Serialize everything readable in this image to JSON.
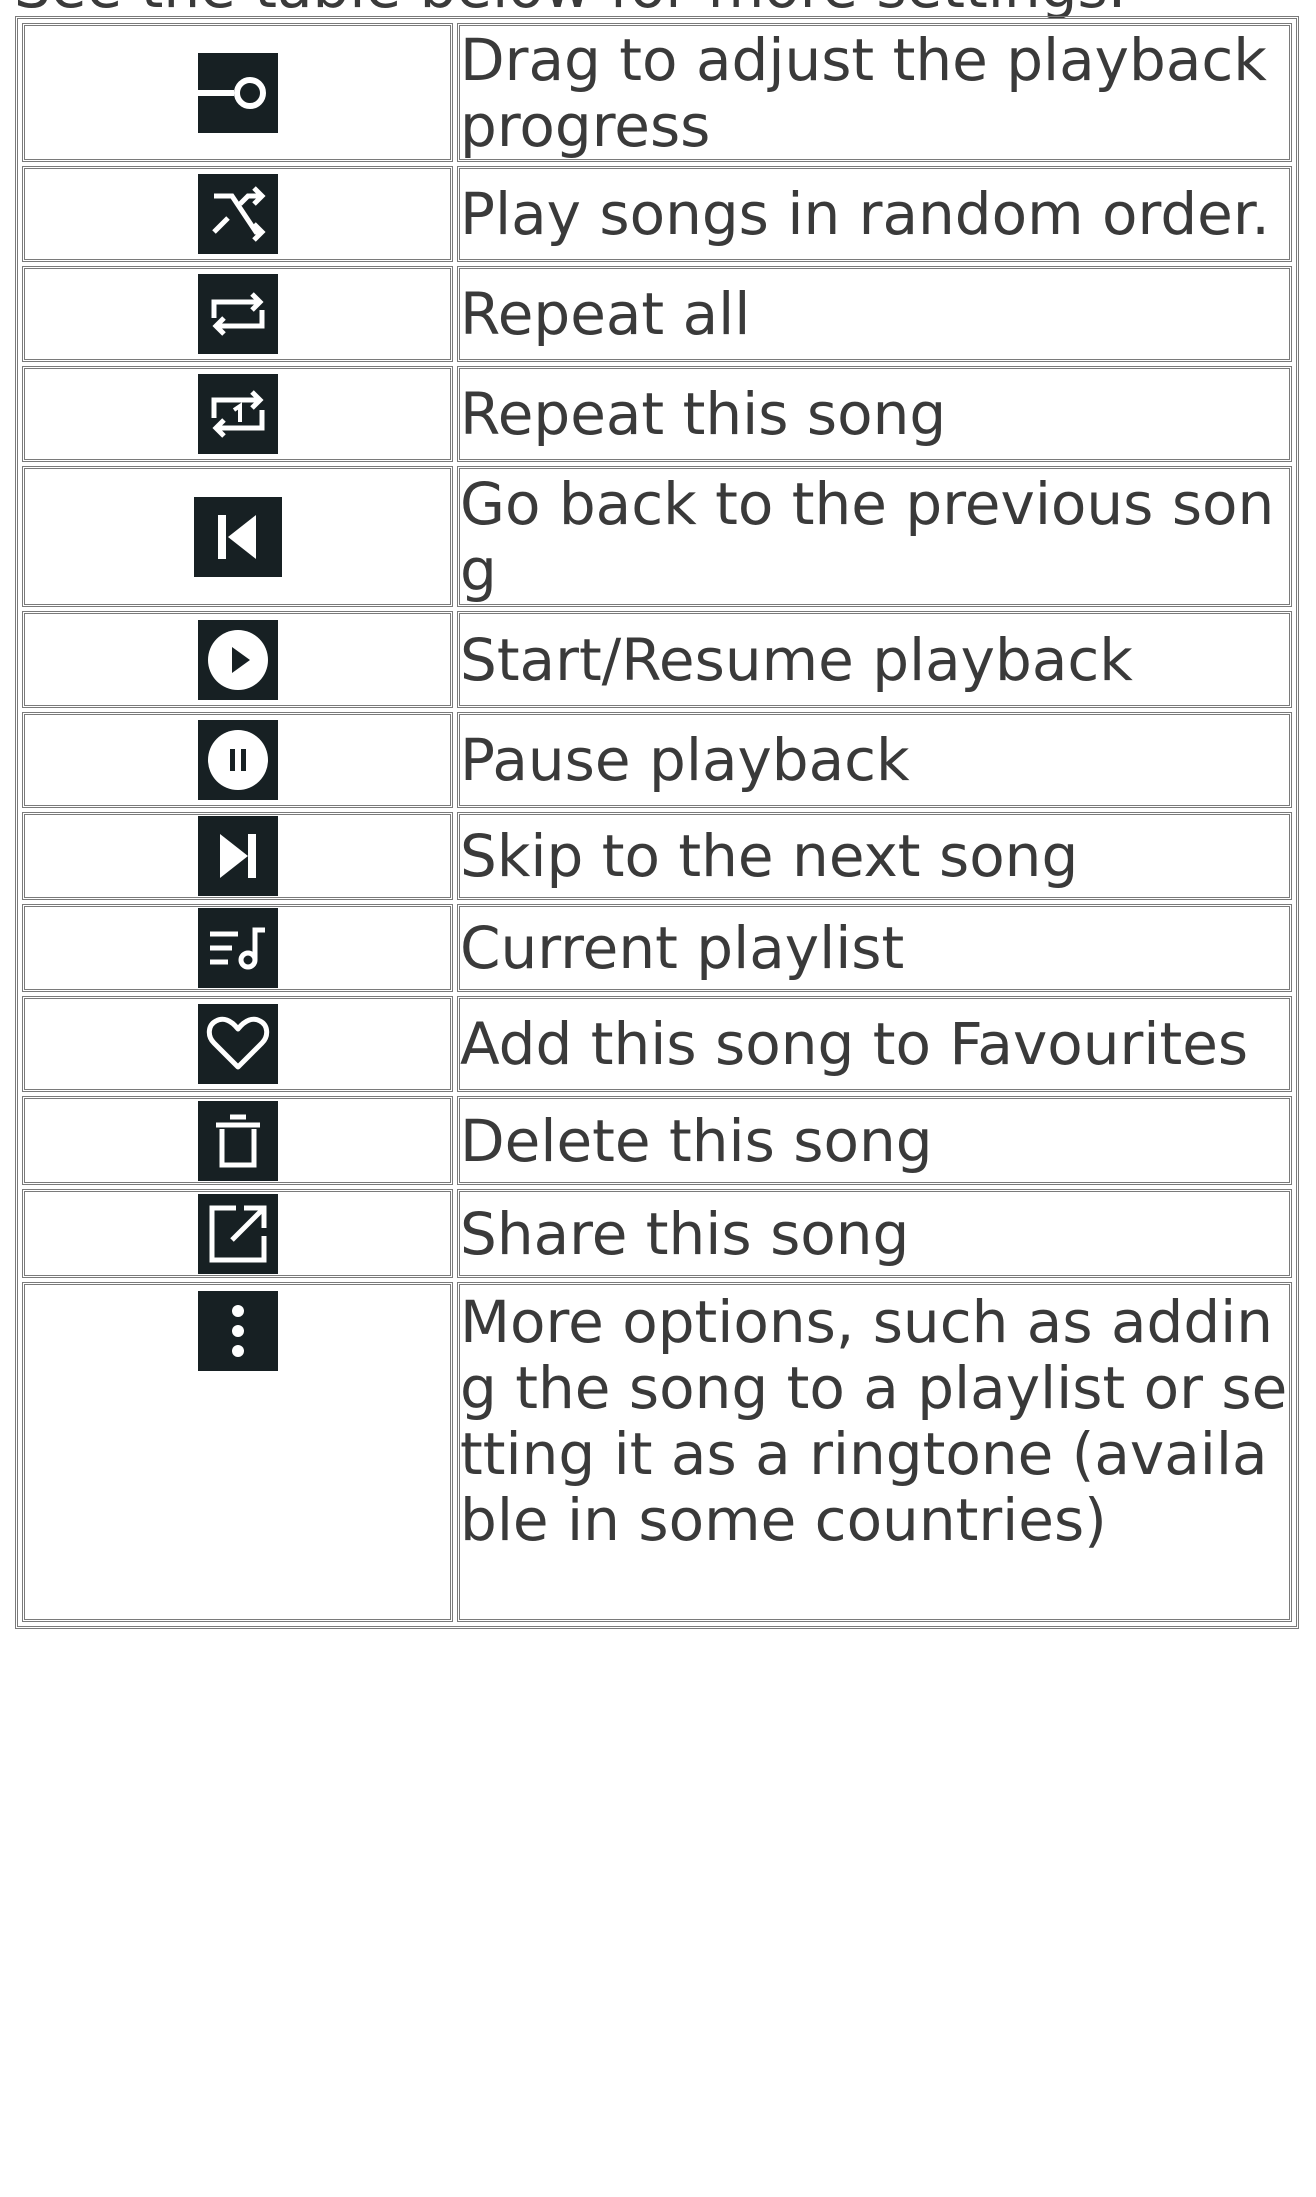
{
  "intro_text": "See the table below for more settings.",
  "rows": [
    {
      "icon": "progress-slider-icon",
      "text": "Drag to adjust the playback progress"
    },
    {
      "icon": "shuffle-icon",
      "text": "Play songs in random order."
    },
    {
      "icon": "repeat-all-icon",
      "text": "Repeat all"
    },
    {
      "icon": "repeat-one-icon",
      "text": "Repeat this song"
    },
    {
      "icon": "previous-track-icon",
      "text": "Go back to the previous song"
    },
    {
      "icon": "play-icon",
      "text": "Start/Resume playback"
    },
    {
      "icon": "pause-icon",
      "text": "Pause playback"
    },
    {
      "icon": "next-track-icon",
      "text": "Skip to the next song"
    },
    {
      "icon": "playlist-icon",
      "text": "Current playlist"
    },
    {
      "icon": "heart-icon",
      "text": "Add this song to Favourites"
    },
    {
      "icon": "trash-icon",
      "text": "Delete this song"
    },
    {
      "icon": "share-icon",
      "text": "Share this song"
    },
    {
      "icon": "more-options-icon",
      "text": "More options, such as adding the song to a playlist or setting it as a ringtone (available in some countries)"
    }
  ],
  "colors": {
    "icon_bg": "#172023",
    "icon_fg": "#ffffff",
    "text": "#3a3a3a",
    "border": "#7a7a7a"
  }
}
